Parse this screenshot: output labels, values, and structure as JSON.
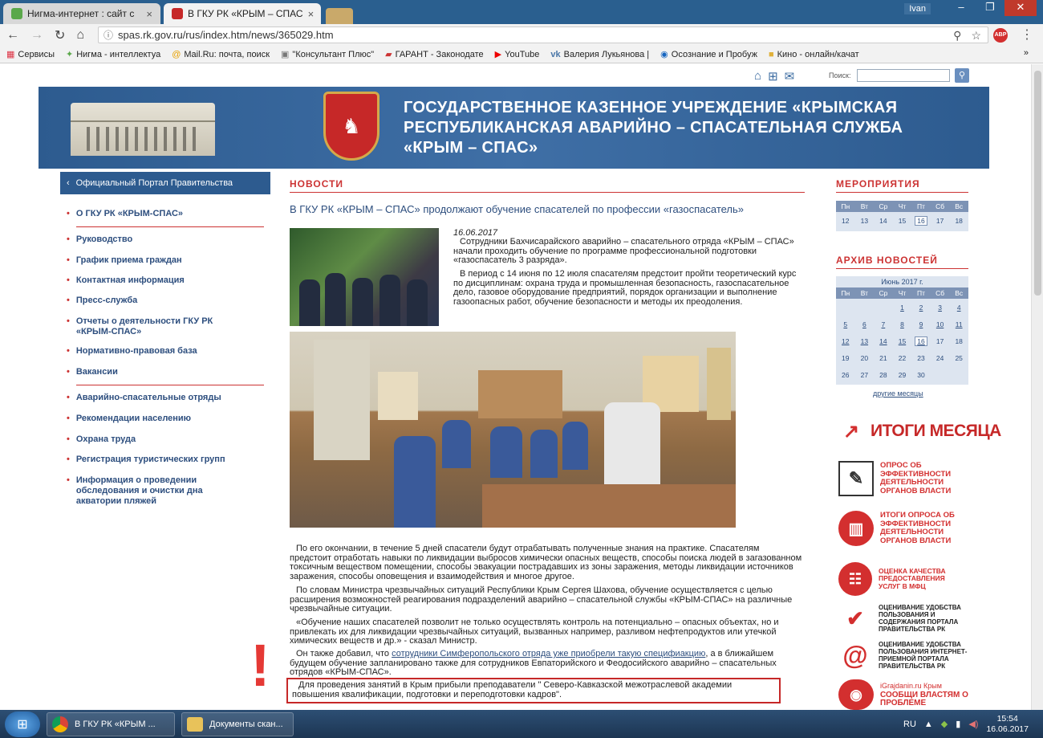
{
  "browser": {
    "tabs": [
      {
        "title": "Нигма-интернет : сайт с",
        "active": false
      },
      {
        "title": "В ГКУ РК «КРЫМ – СПАС",
        "active": true
      }
    ],
    "close_glyph": "×",
    "user": "Ivan",
    "url": "spas.rk.gov.ru/rus/index.htm/news/365029.htm",
    "bookmarks": [
      "Сервисы",
      "Нигма - интеллектуа",
      "Mail.Ru: почта, поиск",
      "\"Консультант Плюс\"",
      "ГАРАНТ - Законодате",
      "YouTube",
      "Валерия Лукьянова |",
      "Осознание и Пробуж",
      "Кино - онлайн/качат"
    ]
  },
  "site": {
    "search_label": "Поиск:",
    "title": "ГОСУДАРСТВЕННОЕ КАЗЕННОЕ УЧРЕЖДЕНИЕ «КРЫМСКАЯ РЕСПУБЛИКАНСКАЯ АВАРИЙНО – СПАСАТЕЛЬНАЯ СЛУЖБА «КРЫМ – СПАС»",
    "nav_head": "Официальный Портал Правительства",
    "nav_items": [
      "О ГКУ РК «КРЫМ-СПАС»",
      "Руководство",
      "График приема граждан",
      "Контактная информация",
      "Пресс-служба",
      "Отчеты о деятельности ГКУ РК «КРЫМ-СПАС»",
      "Нормативно-правовая база",
      "Вакансии",
      "Аварийно-спасательные отряды",
      "Рекомендации населению",
      "Охрана труда",
      "Регистрация туристических групп",
      "Информация о проведении обследования и очистки дна акватории пляжей"
    ]
  },
  "article": {
    "section": "НОВОСТИ",
    "title": "В ГКУ РК «КРЫМ – СПАС» продолжают обучение спасателей по профессии «газоспасатель»",
    "date": "16.06.2017",
    "p1": "Сотрудники Бахчисарайского аварийно – спасательного отряда «КРЫМ – СПАС» начали проходить обучение по программе профессиональной подготовки «газоспасатель 3 разряда».",
    "p2": "В период с 14 июня по 12 июля спасателям предстоит пройти теоретический курс по дисциплинам: охрана труда и промышленная безопасность, газоспасательное дело, газовое оборудование предприятий, порядок организации и выполнение газоопасных работ, обучение безопасности и методы их преодоления.",
    "p3": "По его окончании, в течение 5 дней спасатели будут отрабатывать полученные знания на практике. Спасателям предстоит отработать навыки по ликвидации выбросов химически опасных веществ, способы поиска людей в загазованном токсичным веществом помещении, способы эвакуации пострадавших из зоны заражения, методы ликвидации источников заражения, способы оповещения и взаимодействия и многое другое.",
    "p4": "По словам Министра чрезвычайных ситуаций Республики Крым Сергея Шахова, обучение осуществляется с целью расширения возможностей реагирования подразделений аварийно – спасательной службы «КРЫМ-СПАС» на различные чрезвычайные ситуации.",
    "p5": "«Обучение наших спасателей позволит не только осуществлять контроль на потенциально – опасных объектах, но и привлекать их для ликвидации чрезвычайных ситуаций, вызванных например, разливом нефтепродуктов или утечкой химических веществ и др.» - сказал Министр.",
    "p6_pre": "Он также добавил, что ",
    "p6_link": "сотрудники Симферопольского отряда уже приобрели такую специфиакцию",
    "p6_post": ", а в ближайшем будущем обучение запланировано также для сотрудников Евпаторийского и Феодосийского аварийно – спасательных отрядов «КРЫМ-СПАС».",
    "p7": "Для проведения занятий в Крым прибыли преподаватели \" Северо-Кавказской межотраслевой академии повышения квалификации, подготовки и переподготовки кадров\".",
    "exclaim": "!"
  },
  "sidebar": {
    "events_title": "МЕРОПРИЯТИЯ",
    "archive_title": "АРХИВ НОВОСТЕЙ",
    "weekdays": [
      "Пн",
      "Вт",
      "Ср",
      "Чт",
      "Пт",
      "Сб",
      "Вс"
    ],
    "events_week": [
      "12",
      "13",
      "14",
      "15",
      "16",
      "17",
      "18"
    ],
    "archive_month": "Июнь 2017 г.",
    "archive_weeks": [
      [
        "",
        "",
        "",
        "1",
        "2",
        "3",
        "4"
      ],
      [
        "5",
        "6",
        "7",
        "8",
        "9",
        "10",
        "11"
      ],
      [
        "12",
        "13",
        "14",
        "15",
        "16",
        "17",
        "18"
      ],
      [
        "19",
        "20",
        "21",
        "22",
        "23",
        "24",
        "25"
      ],
      [
        "26",
        "27",
        "28",
        "29",
        "30",
        "",
        ""
      ]
    ],
    "other_months": "другие месяцы",
    "banners": [
      "ИТОГИ МЕСЯЦА",
      "ОПРОС ОБ ЭФФЕКТИВНОСТИ ДЕЯТЕЛЬНОСТИ ОРГАНОВ ВЛАСТИ",
      "ИТОГИ ОПРОСА ОБ ЭФФЕКТИВНОСТИ ДЕЯТЕЛЬНОСТИ ОРГАНОВ ВЛАСТИ",
      "ОЦЕНКА КАЧЕСТВА ПРЕДОСТАВЛЕНИЯ УСЛУГ В МФЦ",
      "ОЦЕНИВАНИЕ УДОБСТВА ПОЛЬЗОВАНИЯ И СОДЕРЖАНИЯ ПОРТАЛА ПРАВИТЕЛЬСТВА РК",
      "ОЦЕНИВАНИЕ УДОБСТВА ПОЛЬЗОВАНИЯ ИНТЕРНЕТ-ПРИЕМНОЙ ПОРТАЛА ПРАВИТЕЛЬСТВА РК",
      "iGrajdanin.ru Крым",
      "СООБЩИ ВЛАСТЯМ О ПРОБЛЕМЕ"
    ]
  },
  "taskbar": {
    "tasks": [
      "В ГКУ РК «КРЫМ ...",
      "Документы скан..."
    ],
    "lang": "RU",
    "time": "15:54",
    "date": "16.06.2017"
  }
}
